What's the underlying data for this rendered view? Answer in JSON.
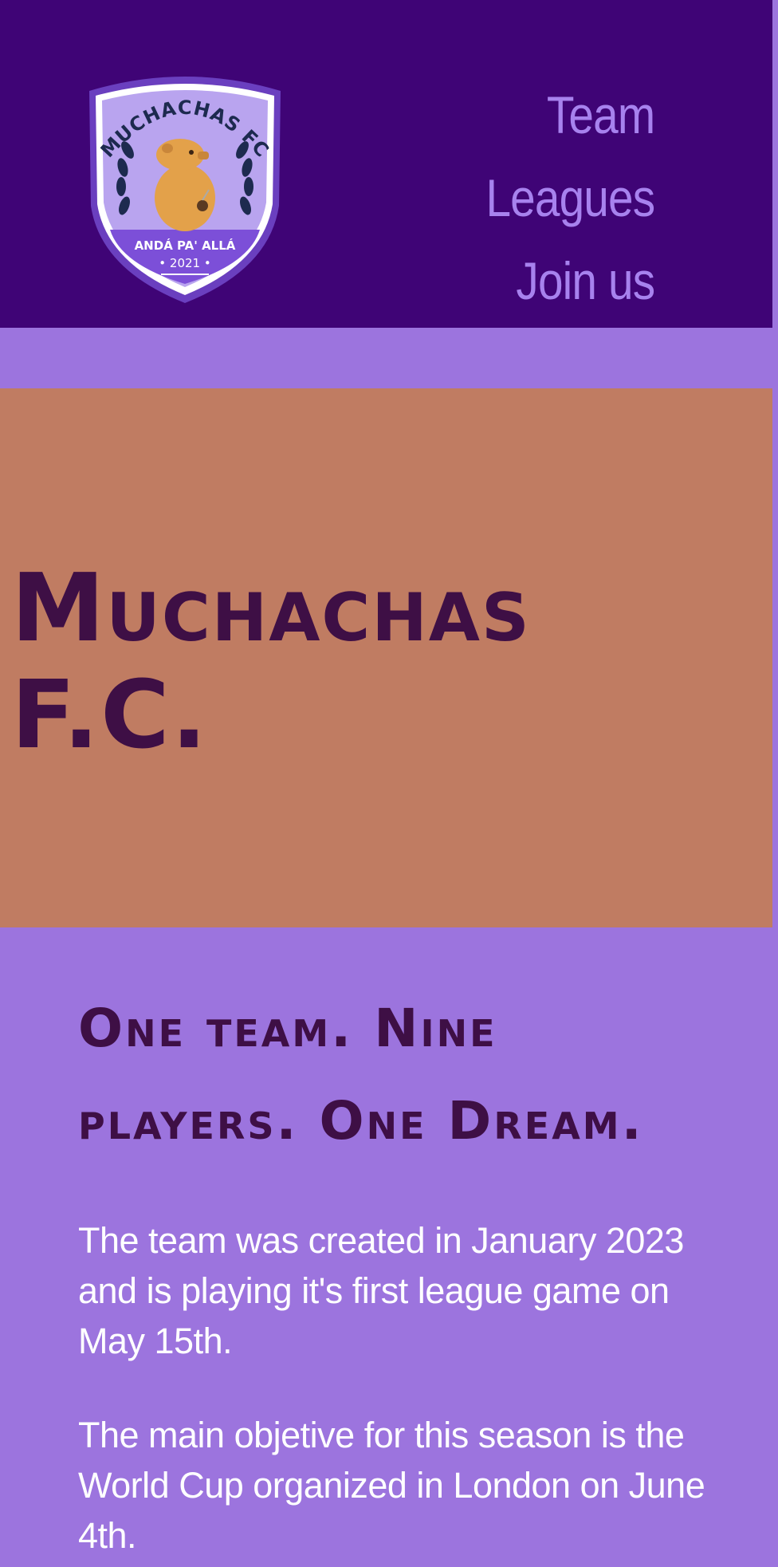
{
  "header": {
    "logo": {
      "text_top": "MUCHACHAS FC",
      "motto": "ANDÁ PA' ALLÁ",
      "year": "• 2021 •",
      "icon": "capybara-crest"
    },
    "nav": [
      {
        "label": "Team"
      },
      {
        "label": "Leagues"
      },
      {
        "label": "Join us"
      }
    ]
  },
  "hero": {
    "title": "Muchachas F.C."
  },
  "content": {
    "tagline": "One team. Nine players. One Dream.",
    "paragraphs": [
      "The team was created in January 2023 and is playing it's first league game on May 15th.",
      "The main objetive for this season is the World Cup organized in London on June 4th."
    ]
  },
  "colors": {
    "header_bg": "#3f0476",
    "page_bg": "#9c74de",
    "hero_bg": "#c07c62",
    "nav_text": "#a782ee",
    "heading_text": "#3e0f45",
    "body_text": "#ffffff"
  }
}
